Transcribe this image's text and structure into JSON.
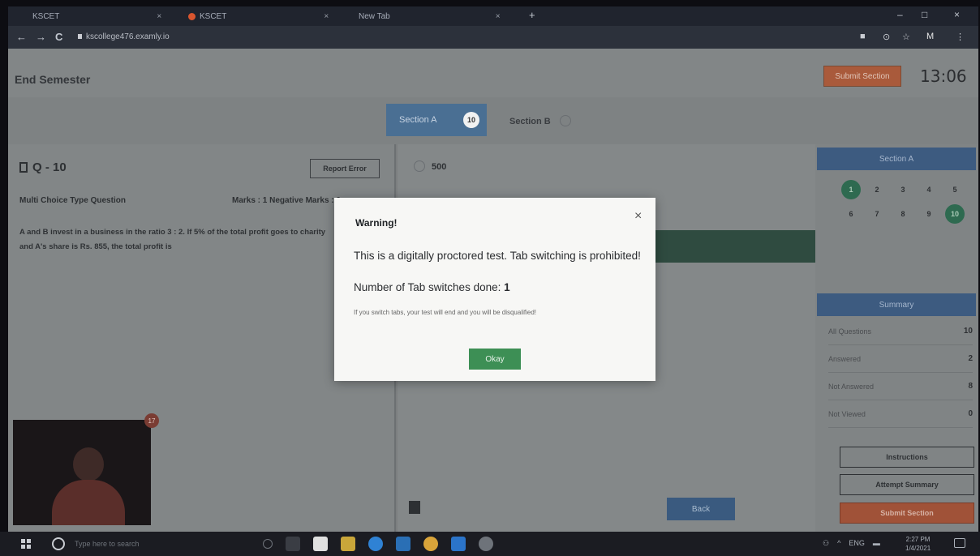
{
  "browser": {
    "tabs": [
      {
        "title": "KSCET"
      },
      {
        "title": "KSCET"
      },
      {
        "title": "New Tab"
      }
    ],
    "new_tab": "+",
    "window_controls": [
      "–",
      "□",
      "×"
    ],
    "nav": {
      "back": "←",
      "forward": "→",
      "reload": "C"
    },
    "url": "kscollege476.examly.io",
    "profile": "M"
  },
  "header": {
    "title": "End Semester",
    "submit_label": "Submit Section",
    "timer": "13:06"
  },
  "sections": {
    "section_a_label": "Section A",
    "section_a_count": "10",
    "section_b_label": "Section B"
  },
  "question": {
    "number": "Q - 10",
    "report_label": "Report Error",
    "type": "Multi Choice Type Question",
    "marks": "Marks : 1  Negative Marks : 0",
    "text": "A and B invest in a business in the ratio 3 : 2. If 5% of the total profit goes to charity and A's share is Rs. 855, the total profit is",
    "webcam_badge": "17"
  },
  "answer": {
    "option_1": "500",
    "back_label": "Back"
  },
  "sidebar": {
    "section_label": "Section A",
    "palette": [
      {
        "n": "1",
        "state": "done"
      },
      {
        "n": "2",
        "state": ""
      },
      {
        "n": "3",
        "state": ""
      },
      {
        "n": "4",
        "state": ""
      },
      {
        "n": "5",
        "state": ""
      },
      {
        "n": "6",
        "state": ""
      },
      {
        "n": "7",
        "state": ""
      },
      {
        "n": "8",
        "state": ""
      },
      {
        "n": "9",
        "state": ""
      },
      {
        "n": "10",
        "state": "done"
      }
    ],
    "summary_label": "Summary",
    "summary": [
      {
        "label": "All Questions",
        "value": "10"
      },
      {
        "label": "Answered",
        "value": "2"
      },
      {
        "label": "Not Answered",
        "value": "8"
      },
      {
        "label": "Not Viewed",
        "value": "0"
      }
    ],
    "instructions_label": "Instructions",
    "attempt_summary_label": "Attempt Summary",
    "submit_label": "Submit Section"
  },
  "modal": {
    "title": "Warning!",
    "close": "×",
    "message": "This is a digitally proctored test. Tab switching is prohibited!",
    "count_label": "Number of Tab switches done:",
    "count_value": "1",
    "note": "If you switch tabs, your test will end and you will be disqualified!",
    "ok_label": "Okay"
  },
  "taskbar": {
    "search_placeholder": "Type here to search",
    "tray_lang": "ENG",
    "time": "2:27 PM",
    "date": "1/4/2021"
  }
}
